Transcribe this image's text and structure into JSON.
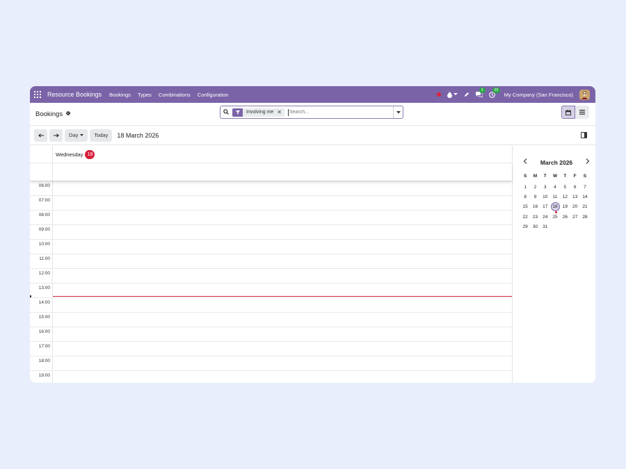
{
  "navbar": {
    "app_title": "Resource Bookings",
    "menu": [
      "Bookings",
      "Types",
      "Combinations",
      "Configuration"
    ],
    "messages_count": "3",
    "activities_count": "65",
    "company": "My Company (San Francisco)",
    "color": "#7b63a8"
  },
  "control": {
    "breadcrumb": "Bookings",
    "facet": "Involving me",
    "search_placeholder": "Search..."
  },
  "toolbar": {
    "scale": "Day",
    "today": "Today",
    "current_date": "18 March 2026"
  },
  "day_header": {
    "day_name": "Wednesday",
    "day_number": "18"
  },
  "hours": [
    "06:00",
    "07:00",
    "08:00",
    "09:00",
    "10:00",
    "11:00",
    "12:00",
    "13:00",
    "14:00",
    "15:00",
    "16:00",
    "17:00",
    "18:00",
    "19:00"
  ],
  "mini_calendar": {
    "title": "March 2026",
    "weekdays": [
      "S",
      "M",
      "T",
      "W",
      "T",
      "F",
      "S"
    ],
    "weeks": [
      [
        "1",
        "2",
        "3",
        "4",
        "5",
        "6",
        "7"
      ],
      [
        "8",
        "9",
        "10",
        "11",
        "12",
        "13",
        "14"
      ],
      [
        "15",
        "16",
        "17",
        "18",
        "19",
        "20",
        "21"
      ],
      [
        "22",
        "23",
        "24",
        "25",
        "26",
        "27",
        "28"
      ],
      [
        "29",
        "30",
        "31",
        "",
        "",
        "",
        ""
      ]
    ],
    "selected": "18"
  }
}
